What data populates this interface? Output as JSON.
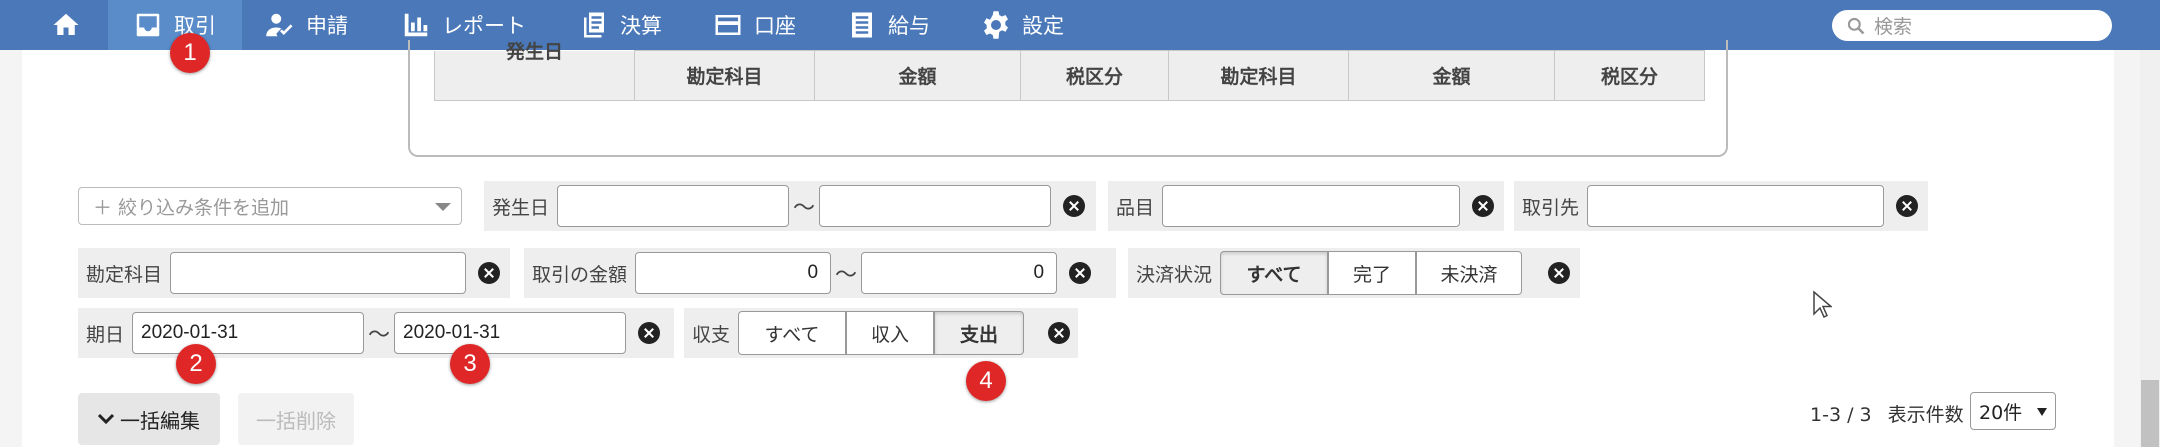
{
  "nav": {
    "items": [
      {
        "label": "",
        "icon": "home-icon"
      },
      {
        "label": "取引",
        "icon": "inbox-icon",
        "active": true
      },
      {
        "label": "申請",
        "icon": "user-check-icon"
      },
      {
        "label": "レポート",
        "icon": "bar-chart-icon"
      },
      {
        "label": "決算",
        "icon": "book-icon"
      },
      {
        "label": "口座",
        "icon": "credit-card-icon"
      },
      {
        "label": "給与",
        "icon": "list-icon"
      },
      {
        "label": "設定",
        "icon": "gear-icon"
      }
    ],
    "search_placeholder": "検索"
  },
  "preview_table": {
    "first_header": "発生日",
    "headers": [
      "勘定科目",
      "金額",
      "税区分",
      "勘定科目",
      "金額",
      "税区分"
    ]
  },
  "filters": {
    "add_filter_placeholder": "＋ 絞り込み条件を追加",
    "issue_date": {
      "label": "発生日",
      "from": "",
      "to": ""
    },
    "item": {
      "label": "品目",
      "value": ""
    },
    "partner": {
      "label": "取引先",
      "value": ""
    },
    "account": {
      "label": "勘定科目",
      "value": ""
    },
    "amount": {
      "label": "取引の金額",
      "from": "0",
      "to": "0"
    },
    "settlement": {
      "label": "決済状況",
      "options": [
        "すべて",
        "完了",
        "未決済"
      ],
      "selected": "すべて"
    },
    "due_date": {
      "label": "期日",
      "from": "2020-01-31",
      "to": "2020-01-31"
    },
    "income_expense": {
      "label": "収支",
      "options": [
        "すべて",
        "収入",
        "支出"
      ],
      "selected": "支出"
    },
    "tilde": "〜"
  },
  "badges": [
    "1",
    "2",
    "3",
    "4"
  ],
  "footer": {
    "bulk_edit": "一括編集",
    "bulk_delete": "一括削除",
    "range": "1-3 / 3",
    "per_page_label": "表示件数",
    "per_page_value": "20件"
  },
  "colors": {
    "nav_bg": "#4a78b9",
    "badge": "#e02727",
    "active_nav": "#5a8cc9"
  }
}
